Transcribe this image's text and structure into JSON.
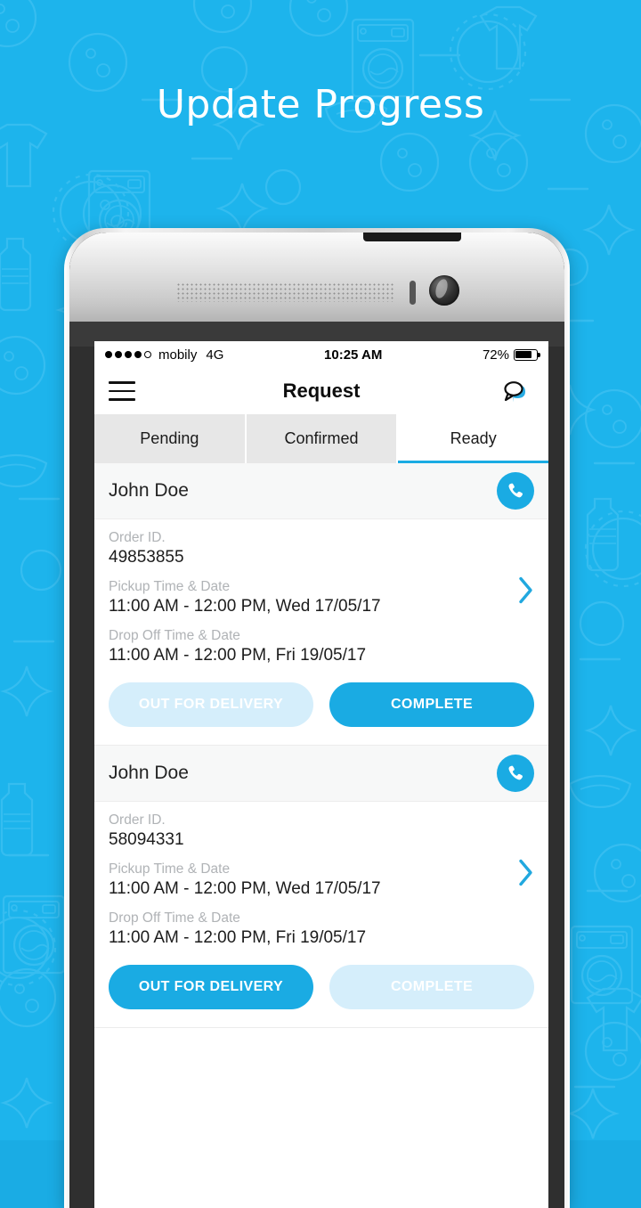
{
  "promo": {
    "title": "Update Progress",
    "bg_color": "#1db4ec",
    "accent_color": "#1aabe3"
  },
  "status_bar": {
    "signal_dots_filled": 4,
    "signal_dots_total": 5,
    "carrier": "mobily",
    "network": "4G",
    "time": "10:25 AM",
    "battery_percent": "72%",
    "battery_level": 72
  },
  "header": {
    "menu_icon": "hamburger-icon",
    "title": "Request",
    "chat_icon": "chat-bubble-icon"
  },
  "tabs": [
    {
      "label": "Pending",
      "active": false
    },
    {
      "label": "Confirmed",
      "active": false
    },
    {
      "label": "Ready",
      "active": true
    }
  ],
  "labels": {
    "order_id": "Order ID.",
    "pickup": "Pickup Time & Date",
    "dropoff": "Drop Off Time & Date",
    "call_icon": "phone-icon",
    "chevron_icon": "chevron-right-icon"
  },
  "orders": [
    {
      "customer": "John Doe",
      "order_id": "49853855",
      "pickup": "11:00 AM - 12:00 PM, Wed 17/05/17",
      "dropoff": "11:00 AM - 12:00 PM, Fri 19/05/17",
      "out_for_delivery_label": "OUT FOR DELIVERY",
      "out_for_delivery_enabled": false,
      "complete_label": "COMPLETE",
      "complete_enabled": true
    },
    {
      "customer": "John Doe",
      "order_id": "58094331",
      "pickup": "11:00 AM - 12:00 PM, Wed 17/05/17",
      "dropoff": "11:00 AM - 12:00 PM, Fri 19/05/17",
      "out_for_delivery_label": "OUT FOR DELIVERY",
      "out_for_delivery_enabled": true,
      "complete_label": "COMPLETE",
      "complete_enabled": false
    }
  ]
}
